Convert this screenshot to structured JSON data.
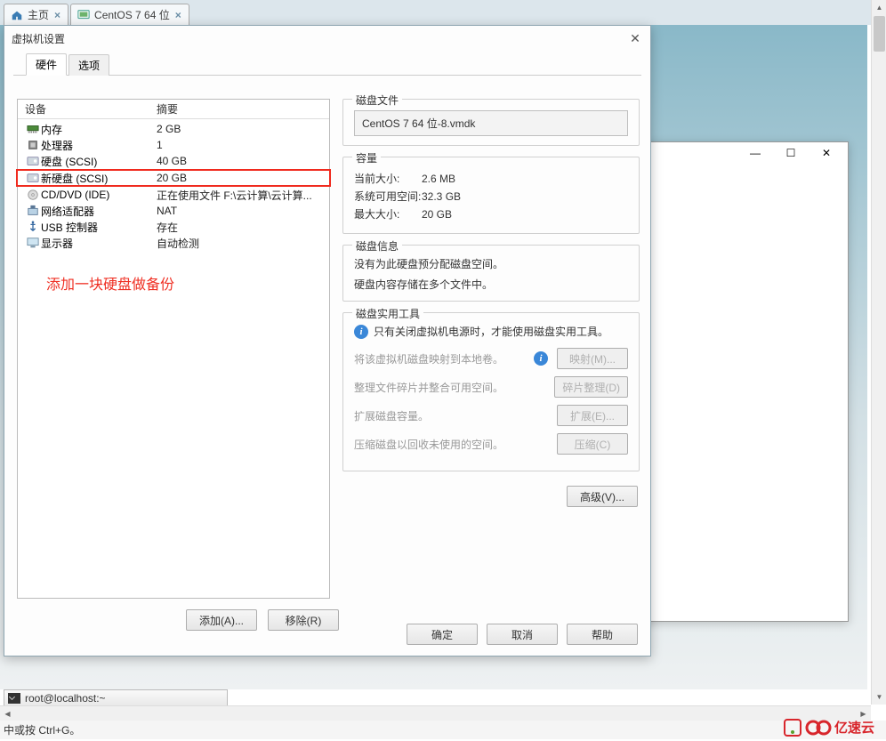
{
  "tabs": {
    "home": "主页",
    "vm": "CentOS 7 64 位"
  },
  "dialog": {
    "title": "虚拟机设置",
    "tab_hw": "硬件",
    "tab_opt": "选项",
    "col_device": "设备",
    "col_summary": "摘要",
    "annotation": "添加一块硬盘做备份",
    "add": "添加(A)...",
    "remove": "移除(R)",
    "ok": "确定",
    "cancel": "取消",
    "help": "帮助"
  },
  "hw": [
    {
      "name": "内存",
      "summary": "2 GB"
    },
    {
      "name": "处理器",
      "summary": "1"
    },
    {
      "name": "硬盘 (SCSI)",
      "summary": "40 GB"
    },
    {
      "name": "新硬盘 (SCSI)",
      "summary": "20 GB"
    },
    {
      "name": "CD/DVD (IDE)",
      "summary": "正在使用文件 F:\\云计算\\云计算..."
    },
    {
      "name": "网络适配器",
      "summary": "NAT"
    },
    {
      "name": "USB 控制器",
      "summary": "存在"
    },
    {
      "name": "显示器",
      "summary": "自动检测"
    }
  ],
  "right": {
    "g_diskfile": "磁盘文件",
    "diskfile_val": "CentOS 7 64 位-8.vmdk",
    "g_capacity": "容量",
    "cap_cur_lab": "当前大小:",
    "cap_cur_val": "2.6 MB",
    "cap_free_lab": "系统可用空间:",
    "cap_free_val": "32.3 GB",
    "cap_max_lab": "最大大小:",
    "cap_max_val": "20 GB",
    "g_diskinfo": "磁盘信息",
    "info_line1": "没有为此硬盘预分配磁盘空间。",
    "info_line2": "硬盘内容存储在多个文件中。",
    "g_util": "磁盘实用工具",
    "util_hint": "只有关闭虚拟机电源时，才能使用磁盘实用工具。",
    "map_txt": "将该虚拟机磁盘映射到本地卷。",
    "map_btn": "映射(M)...",
    "defrag_txt": "整理文件碎片并整合可用空间。",
    "defrag_btn": "碎片整理(D)",
    "expand_txt": "扩展磁盘容量。",
    "expand_btn": "扩展(E)...",
    "compact_txt": "压缩磁盘以回收未使用的空间。",
    "compact_btn": "压缩(C)",
    "advanced_btn": "高级(V)..."
  },
  "taskbar": {
    "term": "root@localhost:~"
  },
  "status": {
    "hint": "中或按 Ctrl+G。"
  },
  "brand": "亿速云"
}
